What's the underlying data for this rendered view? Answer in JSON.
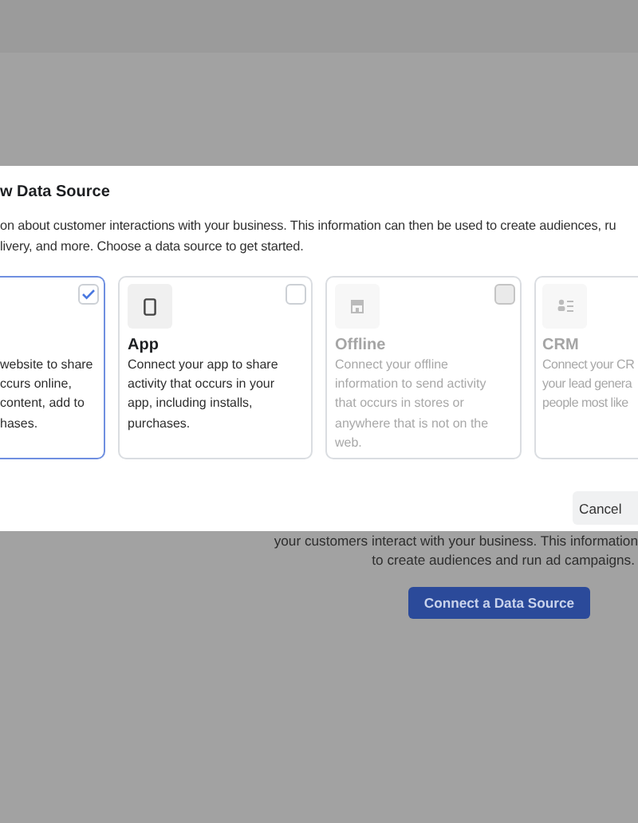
{
  "background": {
    "description_lines": [
      "your customers interact with your business. This information",
      "to create audiences and run ad campaigns."
    ],
    "button": "Connect a Data Source"
  },
  "dialog": {
    "title": "w Data Source",
    "description_lines": [
      "on about customer interactions with your business. This information can then be used to create audiences, ru",
      "livery, and more. Choose a data source to get started."
    ],
    "sources": [
      {
        "description_lines": [
          "website to share",
          "ccurs online,",
          "content, add to",
          "hases."
        ],
        "selected": true,
        "disabled": false,
        "checked": true
      },
      {
        "kind": "app",
        "title": "App",
        "description_lines": [
          "Connect your app to share",
          "activity that occurs in your",
          "app, including installs,",
          "purchases."
        ],
        "selected": false,
        "disabled": false,
        "checked": false
      },
      {
        "kind": "offline",
        "title": "Offline",
        "description_lines": [
          "Connect your offline",
          "information to send activity",
          "that occurs in stores or",
          "anywhere that is not on the",
          "web."
        ],
        "selected": false,
        "disabled": true,
        "checked": false
      },
      {
        "kind": "crm",
        "title": "CRM",
        "description_lines": [
          "Connect your CR",
          "your lead genera",
          "people most like"
        ],
        "selected": false,
        "disabled": true
      }
    ],
    "cancel": "Cancel"
  }
}
